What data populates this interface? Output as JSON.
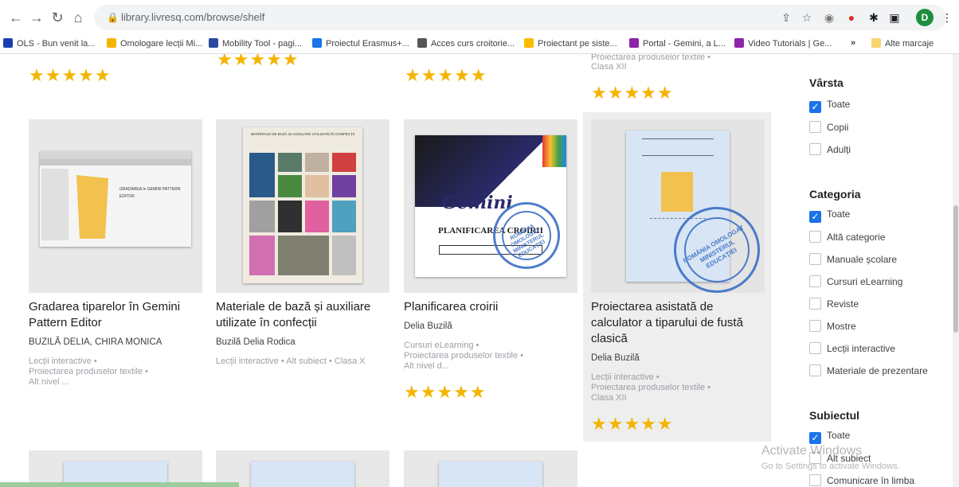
{
  "browser": {
    "url": "library.livresq.com/browse/shelf",
    "profile_initial": "D",
    "bookmarks": [
      {
        "label": "OLS - Bun venit la...",
        "color": "#1a3fb0"
      },
      {
        "label": "Omologare lecții Mi...",
        "color": "#f4b400"
      },
      {
        "label": "Mobility Tool - pagi...",
        "color": "#2b4a9e"
      },
      {
        "label": "Proiectul Erasmus+...",
        "color": "#1a73e8"
      },
      {
        "label": "Acces curs croitorie...",
        "color": "#555555"
      },
      {
        "label": "Proiectant pe siste...",
        "color": "#fbbc04"
      },
      {
        "label": "Portal - Gemini, a L...",
        "color": "#8e24aa"
      },
      {
        "label": "Video Tutorials | Ge...",
        "color": "#8e24aa"
      }
    ],
    "bookmarks_more": "»",
    "bookmarks_other": "Alte marcaje"
  },
  "top_row": [
    {
      "meta": "Proiectarea produselor textile •",
      "grade": "Clasa XII",
      "rating": 5
    }
  ],
  "cards": [
    {
      "title": "Gradarea tiparelor în Gemini Pattern Editor",
      "author": "BUZILĂ DELIA, CHIRA MONICA",
      "meta": [
        "Lecții interactive •",
        "Proiectarea produselor textile •",
        "Alt nivel ..."
      ],
      "thumb_text": "GRADAREA în GEMINI PATTERN EDITOR"
    },
    {
      "title": "Materiale de bază și auxiliare utilizate în confecții",
      "author": "Buzilă Delia Rodica",
      "meta": [
        "Lecții interactive • Alt subiect • Clasa X"
      ],
      "thumb_text": "MATERIALE DE BAZĂ ȘI AUXILIARE UTILIZATE ÎN CONFECȚII"
    },
    {
      "title": "Planificarea croirii",
      "author": "Delia Buzilă",
      "meta": [
        "Cursuri eLearning •",
        "Proiectarea produselor textile •",
        "Alt nivel d..."
      ],
      "rating": 5,
      "thumb_text": "PLANIFICAREA CROIRII",
      "thumb_brand": "Gemini",
      "stamp_text": "ROMÂNIA OMOLOGAT MINISTERUL EDUCAȚIEI"
    },
    {
      "title": "Proiectarea asistată de calculator a tiparului de fustă clasică",
      "author": "Delia Buzilă",
      "meta": [
        "Lecții interactive •",
        "Proiectarea produselor textile •",
        "Clasa XII"
      ],
      "rating": 5,
      "stamp_text": "ROMÂNIA OMOLOGAT MINISTERUL EDUCAȚIEI"
    }
  ],
  "filters": {
    "varsta": {
      "title": "Vârsta",
      "options": [
        {
          "label": "Toate",
          "checked": true
        },
        {
          "label": "Copii",
          "checked": false
        },
        {
          "label": "Adulți",
          "checked": false
        }
      ]
    },
    "categoria": {
      "title": "Categoria",
      "options": [
        {
          "label": "Toate",
          "checked": true
        },
        {
          "label": "Altă categorie",
          "checked": false
        },
        {
          "label": "Manuale școlare",
          "checked": false
        },
        {
          "label": "Cursuri eLearning",
          "checked": false
        },
        {
          "label": "Reviste",
          "checked": false
        },
        {
          "label": "Mostre",
          "checked": false
        },
        {
          "label": "Lecții interactive",
          "checked": false
        },
        {
          "label": "Materiale de prezentare",
          "checked": false
        }
      ]
    },
    "subiectul": {
      "title": "Subiectul",
      "options": [
        {
          "label": "Toate",
          "checked": true
        },
        {
          "label": "Alt subiect",
          "checked": false
        },
        {
          "label": "Comunicare în limba",
          "checked": false
        }
      ]
    }
  },
  "watermark": {
    "line1": "Activate Windows",
    "line2": "Go to Settings to activate Windows."
  },
  "colors": {
    "star": "#f4b400",
    "checkbox": "#1a73e8"
  }
}
